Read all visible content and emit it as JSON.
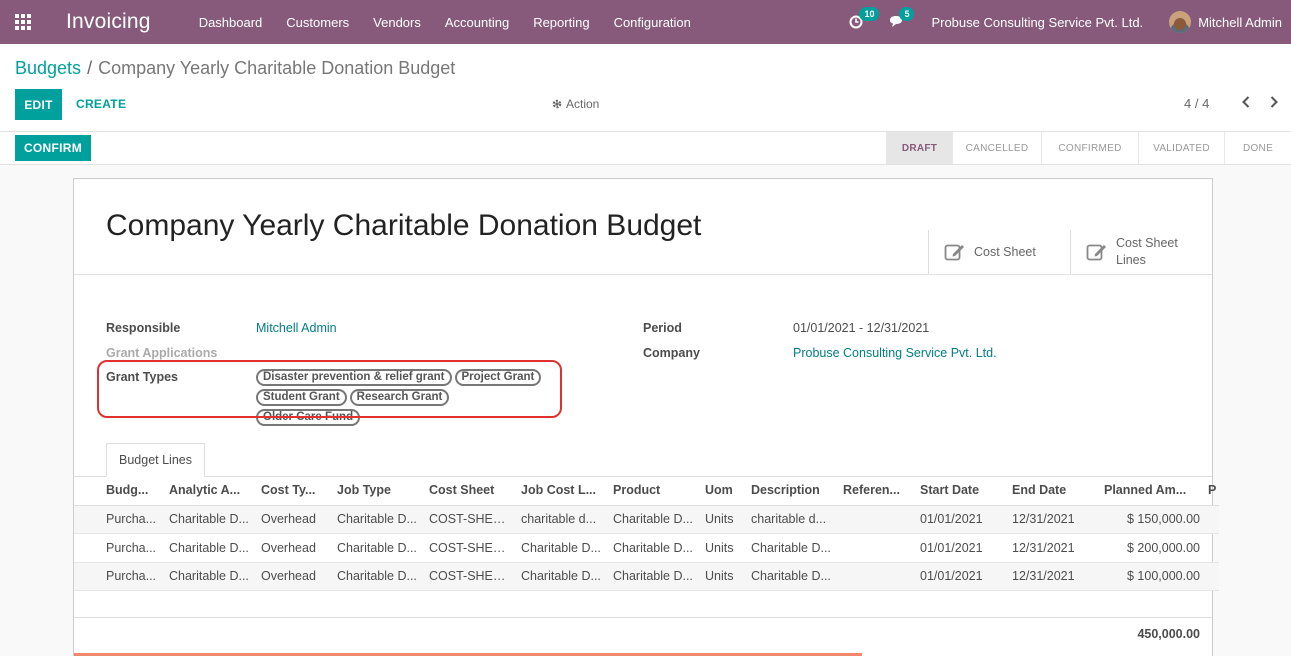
{
  "app": {
    "brand": "Invoicing",
    "menu": [
      "Dashboard",
      "Customers",
      "Vendors",
      "Accounting",
      "Reporting",
      "Configuration"
    ],
    "activity_badge": "10",
    "messages_badge": "5",
    "company": "Probuse Consulting Service Pvt. Ltd.",
    "user": "Mitchell Admin"
  },
  "breadcrumb": {
    "parent": "Budgets",
    "separator": "/",
    "current": "Company Yearly Charitable Donation Budget"
  },
  "toolbar": {
    "edit": "EDIT",
    "create": "CREATE",
    "action": "Action",
    "pager": "4 / 4"
  },
  "statusbar": {
    "confirm": "CONFIRM",
    "stages": [
      "DRAFT",
      "CANCELLED",
      "CONFIRMED",
      "VALIDATED",
      "DONE"
    ],
    "active_stage": "DRAFT"
  },
  "record": {
    "title": "Company Yearly Charitable Donation Budget",
    "smart_buttons": [
      "Cost Sheet",
      "Cost Sheet Lines"
    ],
    "responsible_label": "Responsible",
    "responsible": "Mitchell Admin",
    "grant_applications_label": "Grant Applications",
    "grant_types_label": "Grant Types",
    "grant_types": [
      "Disaster prevention & relief grant",
      "Project Grant",
      "Student Grant",
      "Research Grant",
      "Older Care Fund"
    ],
    "period_label": "Period",
    "period": "01/01/2021 - 12/31/2021",
    "company_label": "Company",
    "company": "Probuse Consulting Service Pvt. Ltd."
  },
  "tab": "Budget Lines",
  "lines": {
    "headers": [
      "Budg...",
      "Analytic A...",
      "Cost Ty...",
      "Job Type",
      "Cost Sheet",
      "Job Cost L...",
      "Product",
      "Uom",
      "Description",
      "Referen...",
      "Start Date",
      "End Date",
      "Planned Am...",
      "P"
    ],
    "rows": [
      [
        "Purcha...",
        "Charitable D...",
        "Overhead",
        "Charitable D...",
        "COST-SHEET...",
        "charitable d...",
        "Charitable D...",
        "Units",
        "charitable d...",
        "",
        "01/01/2021",
        "12/31/2021",
        "$ 150,000.00"
      ],
      [
        "Purcha...",
        "Charitable D...",
        "Overhead",
        "Charitable D...",
        "COST-SHEET...",
        "Charitable D...",
        "Charitable D...",
        "Units",
        "Charitable D...",
        "",
        "01/01/2021",
        "12/31/2021",
        "$ 200,000.00"
      ],
      [
        "Purcha...",
        "Charitable D...",
        "Overhead",
        "Charitable D...",
        "COST-SHEET...",
        "Charitable D...",
        "Charitable D...",
        "Units",
        "Charitable D...",
        "",
        "01/01/2021",
        "12/31/2021",
        "$ 100,000.00"
      ]
    ],
    "total": "450,000.00"
  },
  "colors": {
    "brand": "#875a7b",
    "accent": "#00a09d",
    "highlight": "#e03131"
  },
  "icons": [
    "apps-icon",
    "clock-icon",
    "chat-icon",
    "gear-icon",
    "chevron-left-icon",
    "chevron-right-icon",
    "edit-icon"
  ]
}
